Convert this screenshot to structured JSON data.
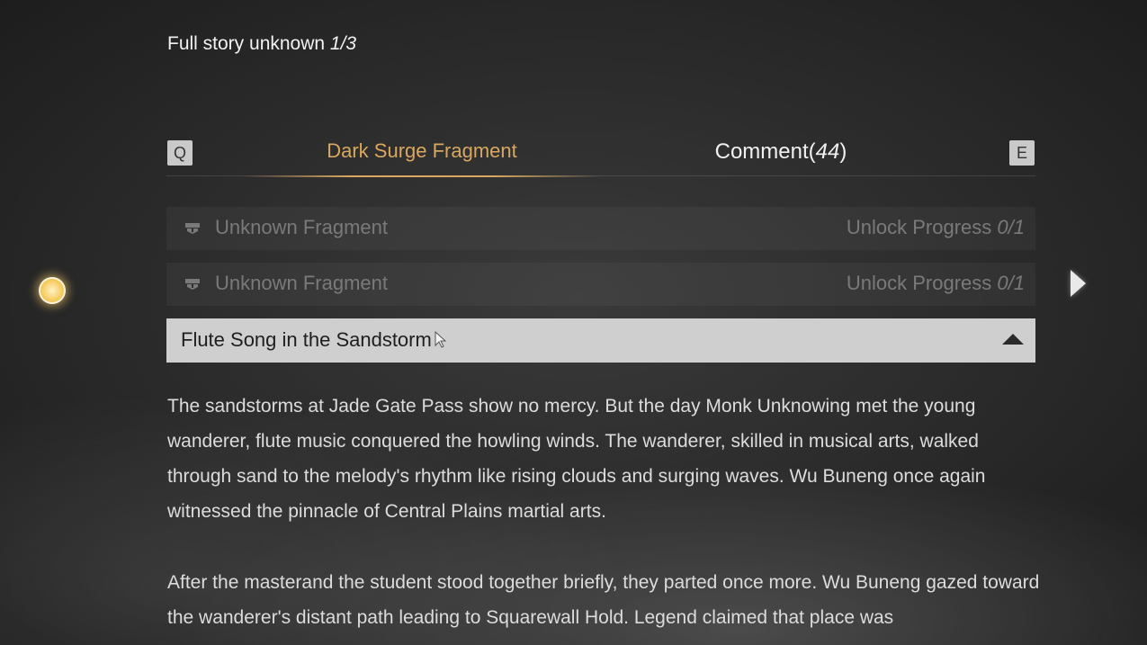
{
  "header": {
    "label": "Full story unknown",
    "count": "1/3"
  },
  "tabs": {
    "prev_key": "Q",
    "next_key": "E",
    "fragment_label": "Dark Surge Fragment",
    "comment_label": "Comment(",
    "comment_count": "44",
    "comment_suffix": ")"
  },
  "fragments": [
    {
      "name": "Unknown Fragment",
      "progress_label": "Unlock Progress",
      "progress_value": "0/1"
    },
    {
      "name": "Unknown Fragment",
      "progress_label": "Unlock Progress",
      "progress_value": "0/1"
    }
  ],
  "expanded": {
    "name": "Flute Song in the Sandstorm"
  },
  "story": {
    "paragraphs": [
      "The sandstorms at Jade Gate Pass show no mercy. But the day Monk Unknowing met the young wanderer, flute music conquered the howling winds. The wanderer, skilled in musical arts, walked through sand to the melody's rhythm like rising clouds and surging waves. Wu Buneng once again witnessed the pinnacle of Central Plains martial arts.",
      "After the masterand the student  stood together briefly, they parted once more. Wu Buneng gazed toward the wanderer's distant path leading to Squarewall Hold. Legend claimed that place was"
    ]
  },
  "colors": {
    "accent": "#d9a760",
    "expanded_bg": "#cfcfcf"
  }
}
